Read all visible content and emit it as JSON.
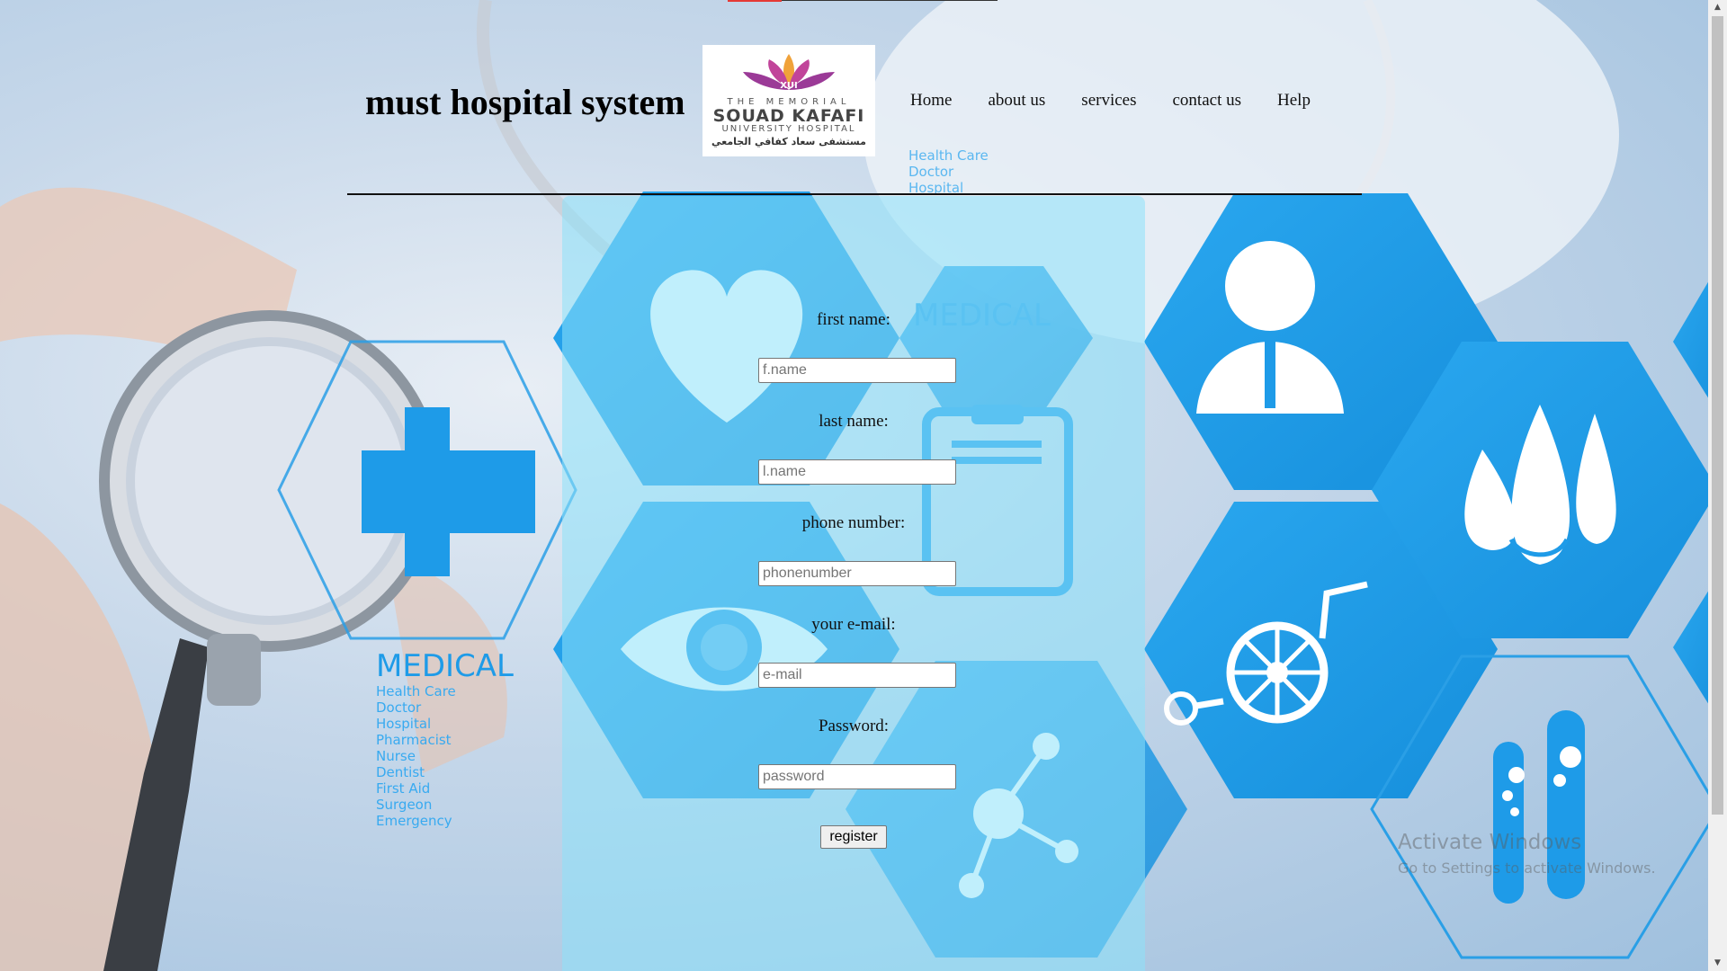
{
  "header": {
    "site_title": "must hospital system",
    "logo": {
      "line1": "THE MEMORIAL",
      "line2": "SOUAD KAFAFI",
      "line3": "UNIVERSITY HOSPITAL",
      "line4": "مستشفى سعاد كفافي الجامعي",
      "badge": "XUI"
    },
    "nav": [
      "Home",
      "about us",
      "services",
      "contact us",
      "Help"
    ]
  },
  "background_text": {
    "medical_heading": "MEDICAL",
    "medical_list": [
      "Health Care",
      "Doctor",
      "Hospital",
      "Pharmacist",
      "Nurse",
      "Dentist",
      "First Aid",
      "Surgeon",
      "Emergency"
    ]
  },
  "form": {
    "first_name_label": "first name:",
    "first_name_placeholder": "f.name",
    "last_name_label": "last name:",
    "last_name_placeholder": "l.name",
    "phone_label": "phone number:",
    "phone_placeholder": "phonenumber",
    "email_label": "your e-mail:",
    "email_placeholder": "e-mail",
    "password_label": "Password:",
    "password_placeholder": "password",
    "register_label": "register"
  },
  "watermark": {
    "title": "Activate Windows",
    "subtitle": "Go to Settings to activate Windows."
  },
  "colors": {
    "hex_blue": "#1e9be8",
    "panel": "#8ce1fa",
    "accent_red": "#e53935"
  }
}
